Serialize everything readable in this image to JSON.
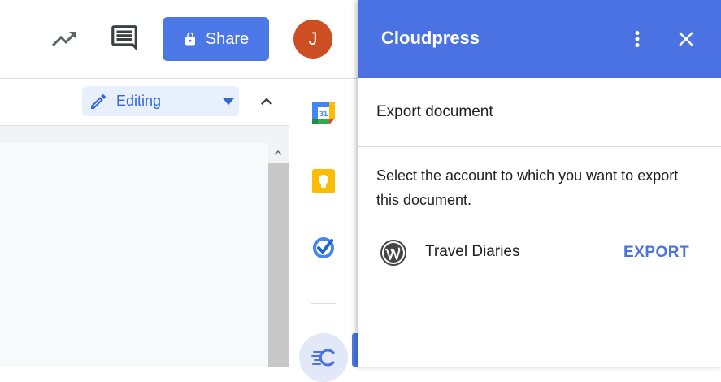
{
  "topbar": {
    "share_label": "Share",
    "avatar_initial": "J",
    "icons": [
      "trending-up-icon",
      "comment-icon",
      "lock-icon"
    ]
  },
  "toolbar": {
    "mode_label": "Editing"
  },
  "addon_rail": {
    "items": [
      "google-calendar-icon",
      "google-keep-icon",
      "google-tasks-icon",
      "cloudpress-icon"
    ],
    "calendar_day": "31"
  },
  "panel": {
    "title": "Cloudpress",
    "subheader": "Export document",
    "description": "Select the account to which you want to export this document.",
    "accounts": [
      {
        "name": "Travel Diaries",
        "icon": "wordpress-icon",
        "action": "EXPORT"
      }
    ]
  },
  "colors": {
    "accent": "#4b72e3",
    "share_button": "#4b78e6",
    "avatar": "#cd4e23",
    "editing_bg": "#e8f0fe"
  }
}
